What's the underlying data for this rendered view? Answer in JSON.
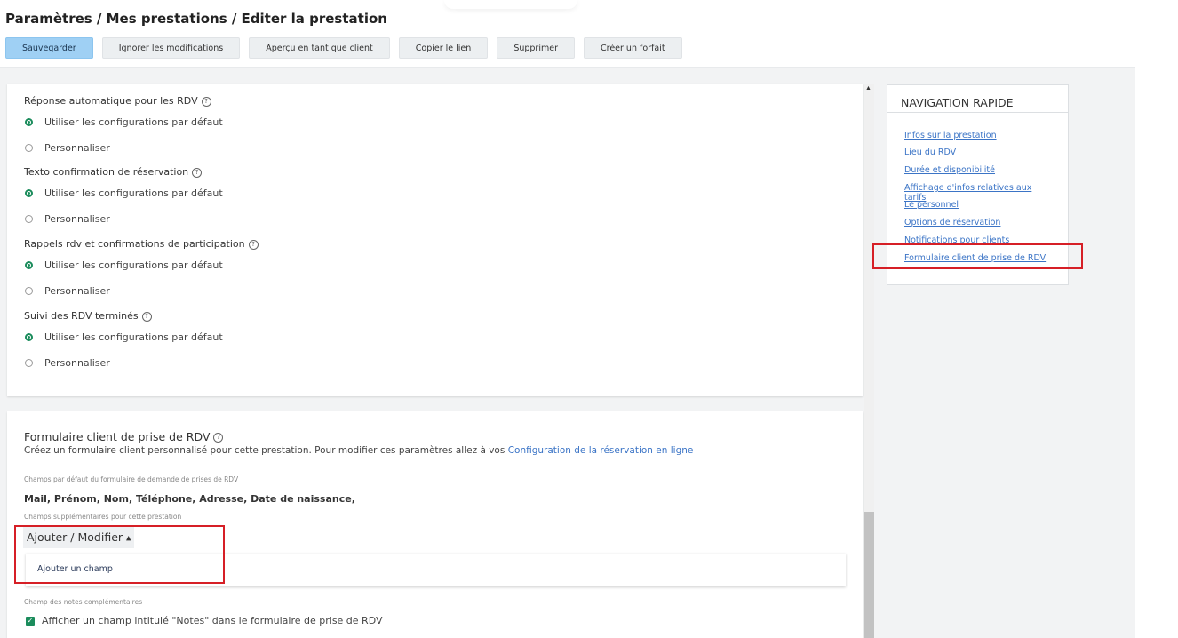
{
  "header": {
    "breadcrumb": "Paramètres / Mes prestations / Editer la prestation"
  },
  "toolbar": {
    "save": "Sauvegarder",
    "ignore": "Ignorer les modifications",
    "preview": "Aperçu en tant que client",
    "copy_link": "Copier le lien",
    "delete": "Supprimer",
    "create_package": "Créer un forfait"
  },
  "notifications": {
    "sections": [
      {
        "label": "Réponse automatique pour les RDV",
        "option_default": "Utiliser les configurations par défaut",
        "option_custom": "Personnaliser"
      },
      {
        "label": "Texto confirmation de réservation",
        "option_default": "Utiliser les configurations par défaut",
        "option_custom": "Personnaliser"
      },
      {
        "label": "Rappels rdv et confirmations de participation",
        "option_default": "Utiliser les configurations par défaut",
        "option_custom": "Personnaliser"
      },
      {
        "label": "Suivi des RDV terminés",
        "option_default": "Utiliser les configurations par défaut",
        "option_custom": "Personnaliser"
      }
    ]
  },
  "form": {
    "title": "Formulaire client de prise de RDV",
    "description": "Créez un formulaire client personnalisé pour cette prestation. Pour modifier ces paramètres allez à vos",
    "link": "Configuration de la réservation en ligne",
    "default_fields_label": "Champs par défaut du formulaire de demande de prises de RDV",
    "default_fields": "Mail, Prénom, Nom, Téléphone, Adresse, Date de naissance,",
    "extra_fields_label": "Champs supplémentaires pour cette prestation",
    "add_modify": "Ajouter / Modifier",
    "add_field": "Ajouter un champ",
    "notes_label": "Champ des notes complémentaires",
    "notes_checkbox": "Afficher un champ intitulé \"Notes\" dans le formulaire de prise de RDV"
  },
  "quick_nav": {
    "title": "NAVIGATION RAPIDE",
    "links": [
      "Infos sur la prestation",
      "Lieu du RDV",
      "Durée et disponibilité",
      "Affichage d'infos relatives aux tarifs",
      "Le personnel",
      "Options de réservation",
      "Notifications pour clients",
      "Formulaire client de prise de RDV"
    ]
  },
  "colors": {
    "primary_button": "#9fd0f4",
    "radio_checked": "#1b8c5c",
    "link": "#3b74c6",
    "highlight_box": "#d61f26"
  }
}
